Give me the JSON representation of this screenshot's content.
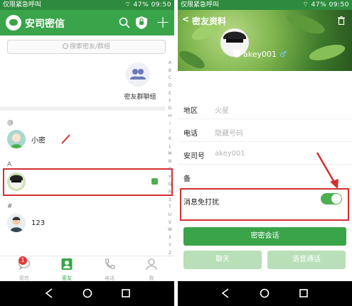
{
  "left": {
    "status": {
      "carrier": "仅限紧急呼叫",
      "battery": "47%",
      "time": "09:50"
    },
    "header": {
      "title": "安司密信"
    },
    "search": {
      "placeholder": "搜索密友/群组"
    },
    "group_chat": {
      "label": "密友群聊组"
    },
    "sections": [
      {
        "letter": "@",
        "contacts": [
          {
            "name": "小密"
          }
        ]
      },
      {
        "letter": "A",
        "contacts": [
          {
            "name": ""
          }
        ]
      },
      {
        "letter": "#",
        "contacts": [
          {
            "name": "123"
          }
        ]
      }
    ],
    "alphabet": [
      "A",
      "B",
      "C",
      "D",
      "E",
      "F",
      "G",
      "H",
      "I",
      "J",
      "K",
      "L",
      "M",
      "N",
      "O",
      "P",
      "Q",
      "R",
      "S",
      "T",
      "U",
      "V",
      "W",
      "X",
      "Y",
      "Z",
      "#"
    ],
    "tabs": [
      {
        "label": "密信",
        "badge": "1"
      },
      {
        "label": "密友"
      },
      {
        "label": "电话"
      },
      {
        "label": "我"
      }
    ]
  },
  "right": {
    "status": {
      "carrier": "仅限紧急呼叫",
      "battery": "47%",
      "time": "09:50"
    },
    "header": {
      "back_label": "密友资料"
    },
    "profile": {
      "name": "akey001",
      "gender_symbol": "♂"
    },
    "info": [
      {
        "label": "地区",
        "value": "火星"
      },
      {
        "label": "电话",
        "value": "隐藏号码"
      },
      {
        "label": "安司号",
        "value": "akey001"
      },
      {
        "label": "备",
        "value": ""
      }
    ],
    "dnd": {
      "label": "消息免打扰",
      "enabled": true
    },
    "buttons": {
      "secret_chat": "密密会话",
      "chat": "聊天",
      "voice_call": "语音通话"
    }
  },
  "colors": {
    "brand_green": "#3aa44a",
    "status_green": "#2e8b3d",
    "highlight_red": "#d32f2f"
  }
}
